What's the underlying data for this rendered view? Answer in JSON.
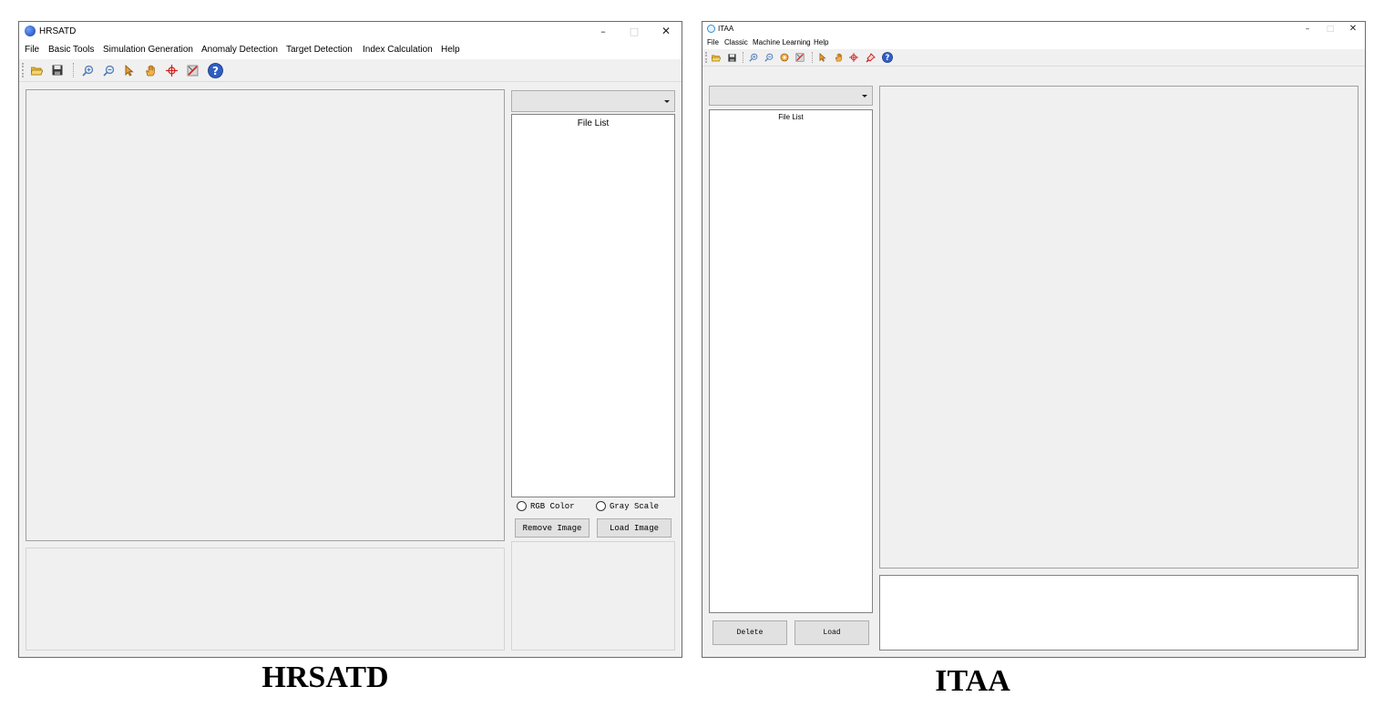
{
  "hrsatd": {
    "title": "HRSATD",
    "controls": {
      "minimize": "–",
      "maximize": "□",
      "close": "✕"
    },
    "menu": [
      "File",
      "Basic Tools",
      "Simulation Generation",
      "Anomaly Detection",
      "Target Detection",
      "Index Calculation",
      "Help"
    ],
    "toolbar": [
      "open-folder-icon",
      "save-icon",
      "zoom-in-icon",
      "zoom-out-icon",
      "pointer-icon",
      "pan-hand-icon",
      "crosshair-icon",
      "clear-icon",
      "help-icon"
    ],
    "file_list_header": "File List",
    "combo_value": "",
    "radio_rgb": "RGB Color",
    "radio_gray": "Gray Scale",
    "remove_button": "Remove Image",
    "load_button": "Load Image",
    "caption": "HRSATD"
  },
  "itaa": {
    "title": "ITAA",
    "controls": {
      "minimize": "–",
      "maximize": "□",
      "close": "✕"
    },
    "menu": [
      "File",
      "Classic",
      "Machine Learning",
      "Help"
    ],
    "toolbar": [
      "open-folder-icon",
      "save-icon",
      "zoom-in-icon",
      "zoom-out-icon",
      "pan-icon",
      "clear-icon",
      "pointer-icon",
      "pan-hand-icon",
      "crosshair-icon",
      "pin-icon",
      "help-icon"
    ],
    "file_list_header": "File List",
    "combo_value": "",
    "delete_button": "Delete",
    "load_button": "Load",
    "caption": "ITAA"
  },
  "colors": {
    "window_bg": "#f0f0f0",
    "titlebar_bg": "#ffffff",
    "help_icon": "#2f5fc4",
    "crosshair": "#d42020",
    "folder": "#e0a020"
  }
}
